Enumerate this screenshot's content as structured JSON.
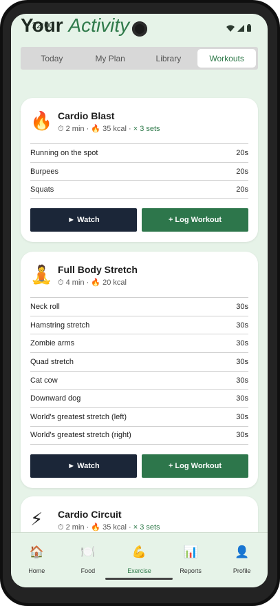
{
  "status": {
    "time": "12:00"
  },
  "header": {
    "title_part1": "Your",
    "title_part2": "Activity"
  },
  "tabs": [
    {
      "label": "Today",
      "active": false
    },
    {
      "label": "My Plan",
      "active": false
    },
    {
      "label": "Library",
      "active": false
    },
    {
      "label": "Workouts",
      "active": true
    }
  ],
  "workouts": [
    {
      "emoji": "🔥",
      "name": "Cardio Blast",
      "duration": "⏱ 2 min",
      "calories": "🔥 35 kcal",
      "sets": "× 3 sets",
      "exercises": [
        {
          "name": "Running on the spot",
          "time": "20s"
        },
        {
          "name": "Burpees",
          "time": "20s"
        },
        {
          "name": "Squats",
          "time": "20s"
        }
      ],
      "watch_label": "► Watch",
      "log_label": "+ Log Workout"
    },
    {
      "emoji": "🧘",
      "name": "Full Body Stretch",
      "duration": "⏱ 4 min",
      "calories": "🔥 20 kcal",
      "sets": "",
      "exercises": [
        {
          "name": "Neck roll",
          "time": "30s"
        },
        {
          "name": "Hamstring stretch",
          "time": "30s"
        },
        {
          "name": "Zombie arms",
          "time": "30s"
        },
        {
          "name": "Quad stretch",
          "time": "30s"
        },
        {
          "name": "Cat cow",
          "time": "30s"
        },
        {
          "name": "Downward dog",
          "time": "30s"
        },
        {
          "name": "World's greatest stretch (left)",
          "time": "30s"
        },
        {
          "name": "World's greatest stretch (right)",
          "time": "30s"
        }
      ],
      "watch_label": "► Watch",
      "log_label": "+ Log Workout"
    },
    {
      "emoji": "⚡",
      "name": "Cardio Circuit",
      "duration": "⏱ 2 min",
      "calories": "🔥 35 kcal",
      "sets": "× 3 sets"
    }
  ],
  "nav": [
    {
      "label": "Home",
      "icon": "home-icon",
      "glyph": "🏠",
      "active": false
    },
    {
      "label": "Food",
      "icon": "food-icon",
      "glyph": "🍽️",
      "active": false
    },
    {
      "label": "Exercise",
      "icon": "exercise-icon",
      "glyph": "💪",
      "active": true
    },
    {
      "label": "Reports",
      "icon": "reports-icon",
      "glyph": "📊",
      "active": false
    },
    {
      "label": "Profile",
      "icon": "profile-icon",
      "glyph": "👤",
      "active": false
    }
  ],
  "colors": {
    "accent": "#2f7a4a",
    "watch_button": "#1b2638",
    "log_button": "#2d764b",
    "background": "#e6f3e8"
  }
}
